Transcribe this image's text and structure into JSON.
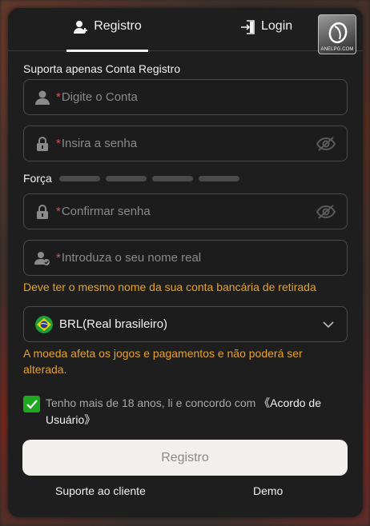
{
  "tabs": {
    "register_label": "Registro",
    "login_label": "Login"
  },
  "logo": {
    "text": "ANELPG.COM"
  },
  "form": {
    "section_title": "Suporta apenas Conta Registro",
    "required_mark": "*",
    "account": {
      "placeholder": "Digite o Conta",
      "value": ""
    },
    "password": {
      "placeholder": "Insira a senha",
      "value": ""
    },
    "strength": {
      "label": "Força",
      "segments": 4,
      "filled": 0
    },
    "confirm": {
      "placeholder": "Confirmar senha",
      "value": ""
    },
    "real_name": {
      "placeholder": "Introduza o seu nome real",
      "value": ""
    },
    "real_name_hint": "Deve ter o mesmo nome da sua conta bancária de retirada",
    "currency": {
      "value": "BRL(Real brasileiro)",
      "flag": "brazil-flag"
    },
    "currency_hint": "A moeda afeta os jogos e pagamentos e não poderá ser alterada.",
    "agree": {
      "checked": true,
      "text": "Tenho mais de 18 anos, li e concordo com ",
      "link": "《Acordo de Usuário》"
    },
    "submit_label": "Registro"
  },
  "footer": {
    "support_label": "Suporte ao cliente",
    "demo_label": "Demo"
  },
  "colors": {
    "modal_bg": "#1e1e1e",
    "hint": "#e8a227",
    "required": "#d9534f",
    "checkbox": "#1fa81f",
    "submit_bg": "#f1f0ec"
  }
}
